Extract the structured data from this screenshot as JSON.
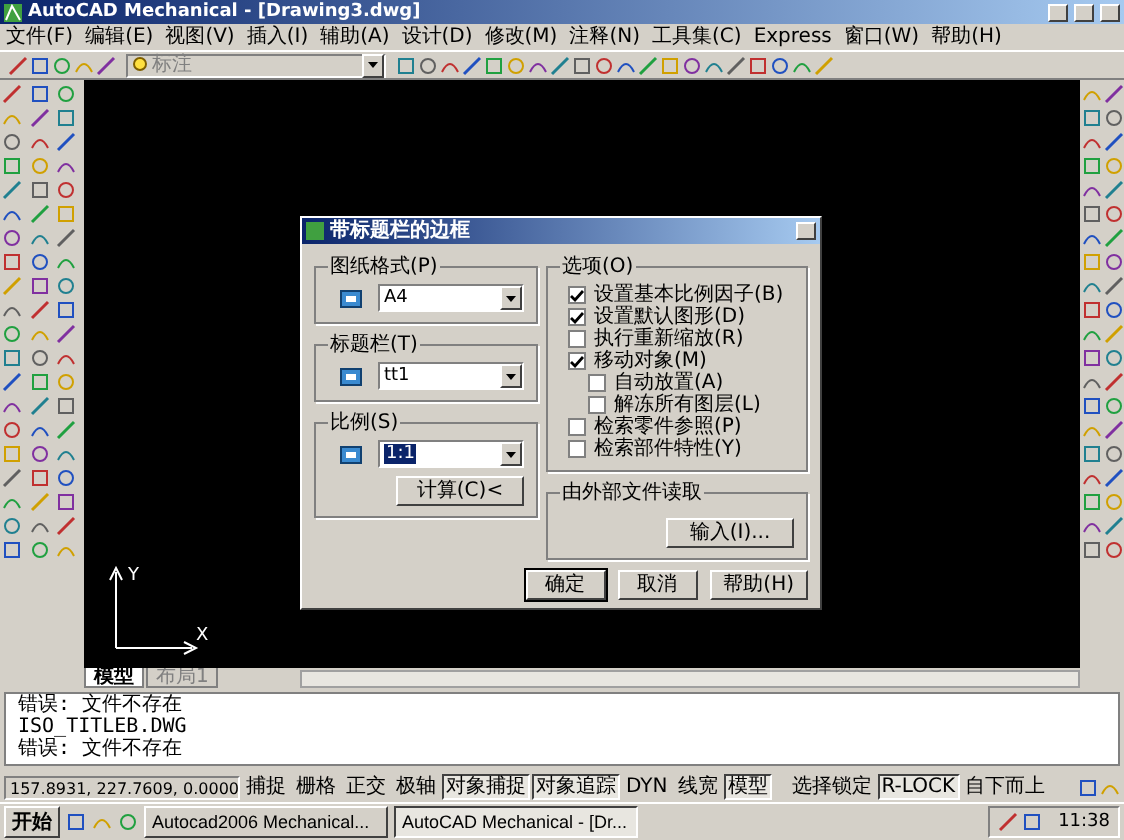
{
  "window": {
    "title": "AutoCAD Mechanical - [Drawing3.dwg]"
  },
  "menu": [
    "文件(F)",
    "编辑(E)",
    "视图(V)",
    "插入(I)",
    "辅助(A)",
    "设计(D)",
    "修改(M)",
    "注释(N)",
    "工具集(C)",
    "Express",
    "窗口(W)",
    "帮助(H)"
  ],
  "toolbar": {
    "layer": "标注"
  },
  "ucs": {
    "x_label": "X",
    "y_label": "Y"
  },
  "layout_tabs": [
    {
      "label": "模型",
      "selected": true
    },
    {
      "label": "布局1",
      "selected": false
    }
  ],
  "dialog": {
    "title": "带标题栏的边框",
    "paper_format": {
      "label": "图纸格式(P)",
      "value": "A4"
    },
    "title_block": {
      "label": "标题栏(T)",
      "value": "tt1"
    },
    "scale": {
      "label": "比例(S)",
      "value": "1:1",
      "button": "计算(C)<"
    },
    "options": {
      "label": "选项(O)",
      "items": [
        {
          "label": "设置基本比例因子(B)",
          "checked": true
        },
        {
          "label": "设置默认图形(D)",
          "checked": true
        },
        {
          "label": "执行重新缩放(R)",
          "checked": false
        },
        {
          "label": "移动对象(M)",
          "checked": true,
          "children": [
            {
              "label": "自动放置(A)",
              "checked": false
            },
            {
              "label": "解冻所有图层(L)",
              "checked": false
            }
          ]
        },
        {
          "label": "检索零件参照(P)",
          "checked": false
        },
        {
          "label": "检索部件特性(Y)",
          "checked": false
        }
      ]
    },
    "external": {
      "label": "由外部文件读取",
      "button": "输入(I)..."
    },
    "buttons": [
      "确定",
      "取消",
      "帮助(H)"
    ]
  },
  "command_lines": [
    "错误: 文件不存在",
    "ISO_TITLEB.DWG",
    "错误: 文件不存在"
  ],
  "status_bar": {
    "coordinates": "157.8931, 227.7609, 0.0000",
    "toggles": [
      {
        "label": "捕捉",
        "on": false
      },
      {
        "label": "栅格",
        "on": false
      },
      {
        "label": "正交",
        "on": false
      },
      {
        "label": "极轴",
        "on": false
      },
      {
        "label": "对象捕捉",
        "on": true
      },
      {
        "label": "对象追踪",
        "on": true
      },
      {
        "label": "DYN",
        "on": false
      },
      {
        "label": "线宽",
        "on": false
      },
      {
        "label": "模型",
        "on": true
      }
    ],
    "extra": [
      {
        "label": "选择锁定",
        "on": false
      },
      {
        "label": "R-LOCK",
        "on": true
      },
      {
        "label": "自下而上",
        "on": false
      }
    ]
  },
  "taskbar": {
    "start": "开始",
    "tasks": [
      {
        "label": "Autocad2006 Mechanical...",
        "selected": false
      },
      {
        "label": "AutoCAD Mechanical - [Dr...",
        "selected": true
      }
    ],
    "clock": "11:38"
  }
}
